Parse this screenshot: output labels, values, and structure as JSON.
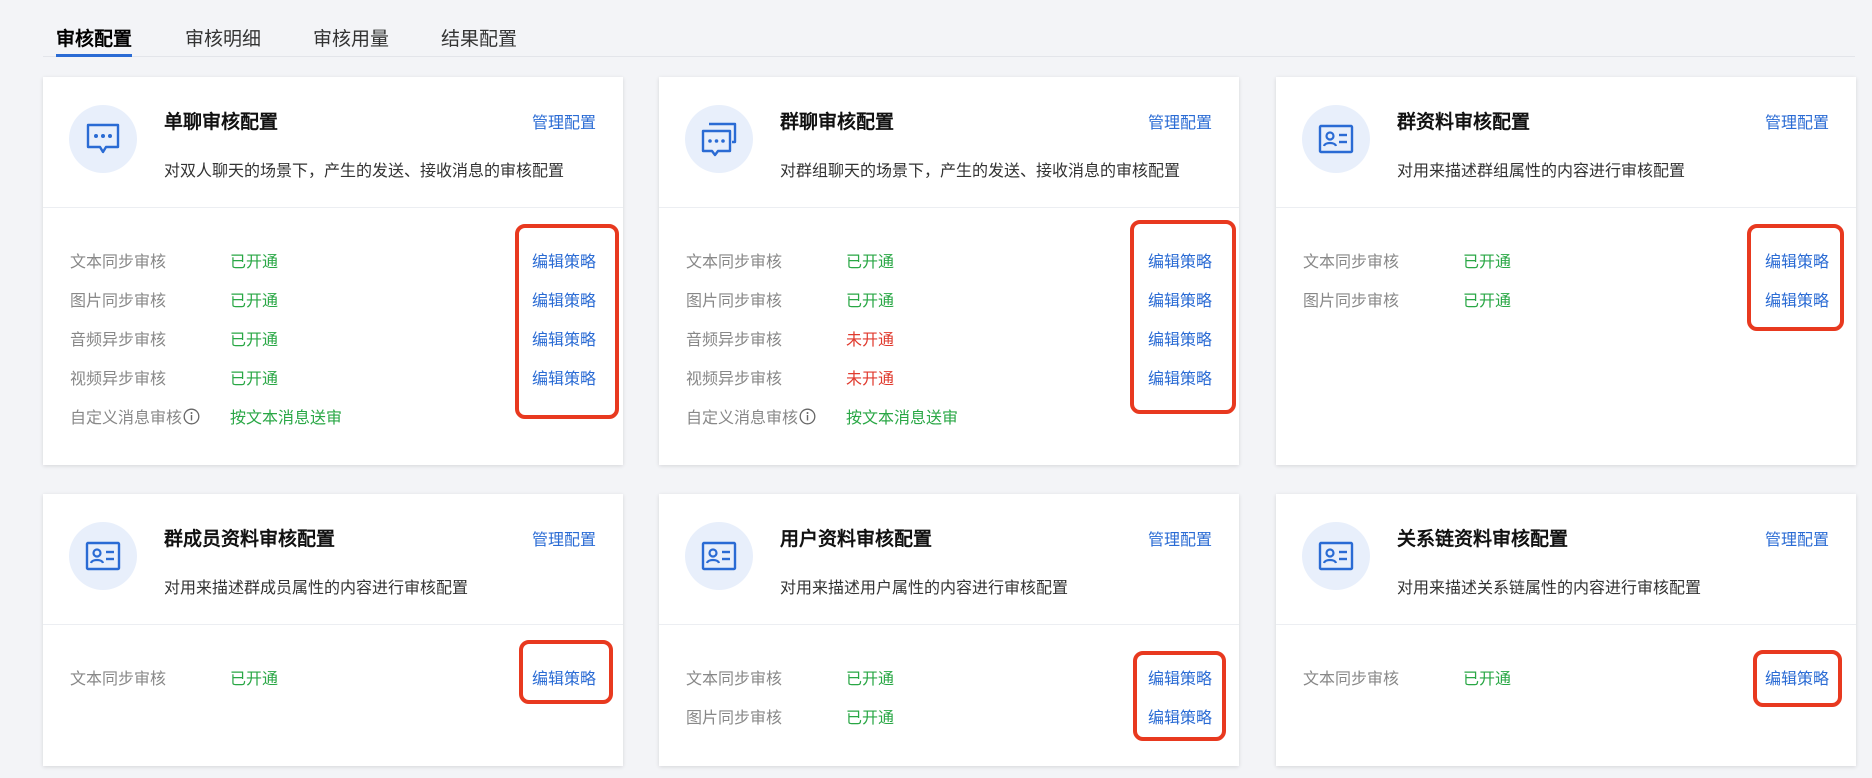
{
  "tabs": [
    {
      "label": "审核配置",
      "active": true
    },
    {
      "label": "审核明细",
      "active": false
    },
    {
      "label": "审核用量",
      "active": false
    },
    {
      "label": "结果配置",
      "active": false
    }
  ],
  "colors": {
    "accent": "#2a6bd4",
    "enabled": "#29a745",
    "disabled": "#e03a2e",
    "highlight": "#e8391f"
  },
  "cards": [
    {
      "title": "单聊审核配置",
      "desc": "对双人聊天的场景下，产生的发送、接收消息的审核配置",
      "manage": "管理配置",
      "icon": "chat-bubble-icon",
      "rows": [
        {
          "label": "文本同步审核",
          "status": "已开通",
          "edit": "编辑策略"
        },
        {
          "label": "图片同步审核",
          "status": "已开通",
          "edit": "编辑策略"
        },
        {
          "label": "音频异步审核",
          "status": "已开通",
          "edit": "编辑策略"
        },
        {
          "label": "视频异步审核",
          "status": "已开通",
          "edit": "编辑策略"
        },
        {
          "label": "自定义消息审核",
          "status": "按文本消息送审"
        }
      ]
    },
    {
      "title": "群聊审核配置",
      "desc": "对群组聊天的场景下，产生的发送、接收消息的审核配置",
      "manage": "管理配置",
      "icon": "group-chat-icon",
      "rows": [
        {
          "label": "文本同步审核",
          "status": "已开通",
          "edit": "编辑策略"
        },
        {
          "label": "图片同步审核",
          "status": "已开通",
          "edit": "编辑策略"
        },
        {
          "label": "音频异步审核",
          "status": "未开通",
          "edit": "编辑策略"
        },
        {
          "label": "视频异步审核",
          "status": "未开通",
          "edit": "编辑策略"
        },
        {
          "label": "自定义消息审核",
          "status": "按文本消息送审"
        }
      ]
    },
    {
      "title": "群资料审核配置",
      "desc": "对用来描述群组属性的内容进行审核配置",
      "manage": "管理配置",
      "icon": "profile-card-icon",
      "rows": [
        {
          "label": "文本同步审核",
          "status": "已开通",
          "edit": "编辑策略"
        },
        {
          "label": "图片同步审核",
          "status": "已开通",
          "edit": "编辑策略"
        }
      ]
    },
    {
      "title": "群成员资料审核配置",
      "desc": "对用来描述群成员属性的内容进行审核配置",
      "manage": "管理配置",
      "icon": "profile-card-icon",
      "rows": [
        {
          "label": "文本同步审核",
          "status": "已开通",
          "edit": "编辑策略"
        }
      ]
    },
    {
      "title": "用户资料审核配置",
      "desc": "对用来描述用户属性的内容进行审核配置",
      "manage": "管理配置",
      "icon": "profile-card-icon",
      "rows": [
        {
          "label": "文本同步审核",
          "status": "已开通",
          "edit": "编辑策略"
        },
        {
          "label": "图片同步审核",
          "status": "已开通",
          "edit": "编辑策略"
        }
      ]
    },
    {
      "title": "关系链资料审核配置",
      "desc": "对用来描述关系链属性的内容进行审核配置",
      "manage": "管理配置",
      "icon": "profile-card-icon",
      "rows": [
        {
          "label": "文本同步审核",
          "status": "已开通",
          "edit": "编辑策略"
        }
      ]
    }
  ]
}
